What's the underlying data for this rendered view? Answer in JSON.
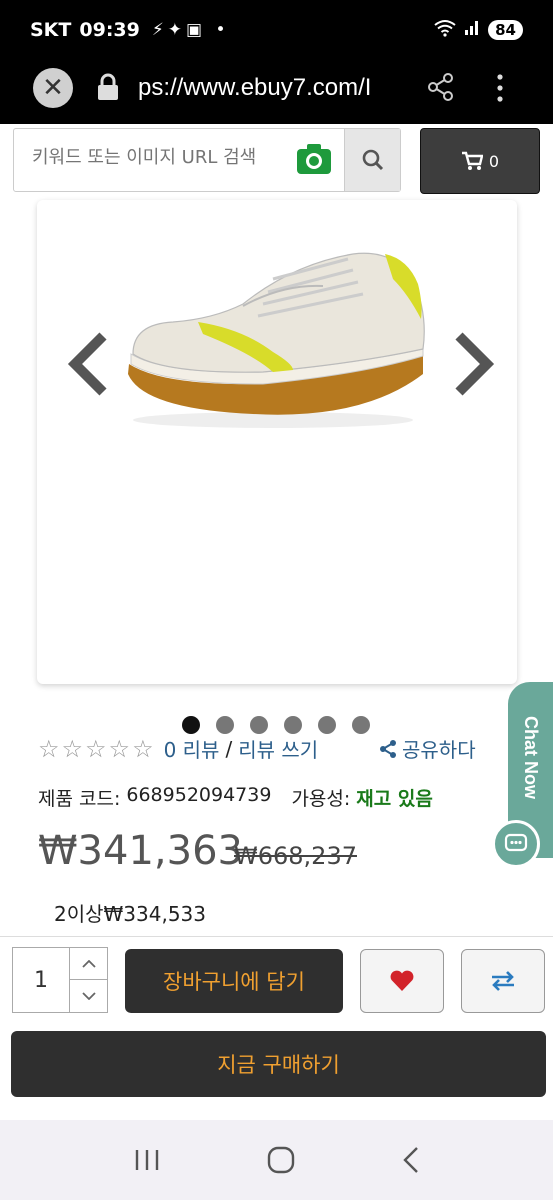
{
  "status_bar": {
    "carrier": "SKT",
    "time": "09:39",
    "battery": "84"
  },
  "browser": {
    "url": "ps://www.ebuy7.com/I"
  },
  "search": {
    "placeholder": "키워드 또는 이미지 URL 검색"
  },
  "cart": {
    "count": "0"
  },
  "gallery": {
    "slide_count": 6,
    "active_slide": 0
  },
  "rating": {
    "review_count": "0 리뷰",
    "write_review": "리뷰 쓰기",
    "separator": "/",
    "share": "공유하다"
  },
  "product": {
    "code_label": "제품 코드:",
    "code": "668952094739",
    "availability_label": "가용성:",
    "availability": "재고 있음",
    "price": "₩341,363",
    "old_price": "₩668,237",
    "tier_price": "2이상₩334,533"
  },
  "chat": {
    "label": "Chat Now"
  },
  "actions": {
    "quantity": "1",
    "add_to_cart": "장바구니에 담기",
    "buy_now": "지금 구매하기"
  },
  "colors": {
    "accent": "#f0a030",
    "availability": "#1a7a1a",
    "link": "#2d5f8b",
    "chat": "#6aa89a"
  }
}
